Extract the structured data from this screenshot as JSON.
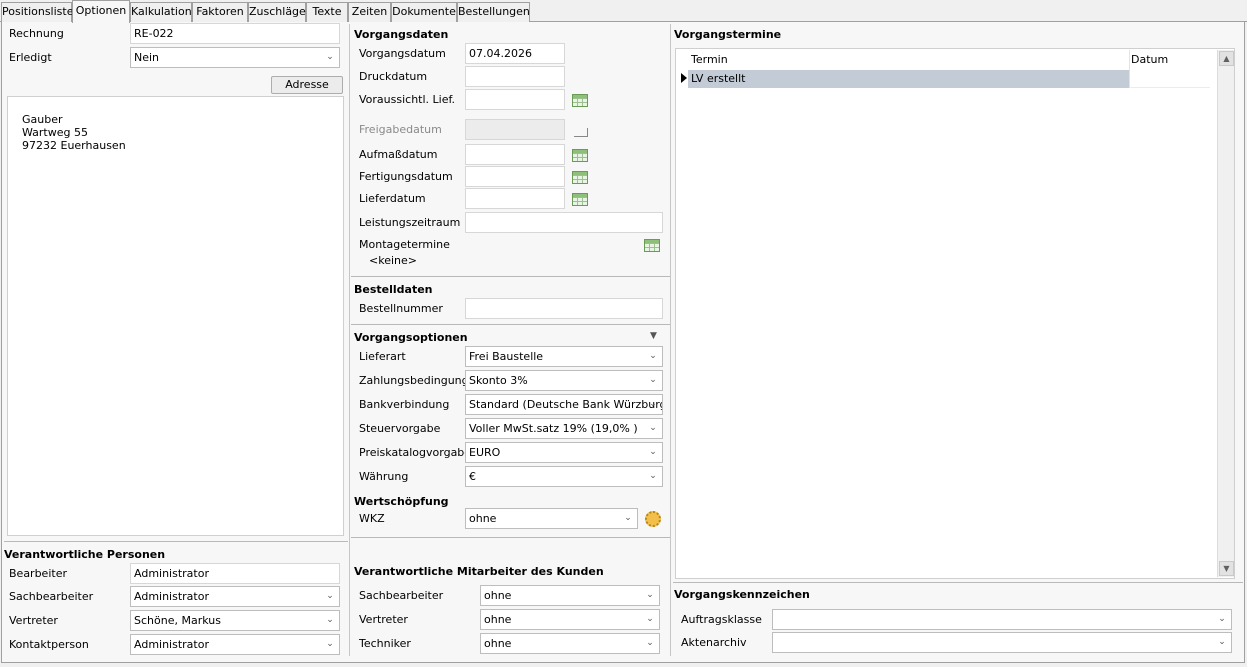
{
  "tabs": [
    "Positionsliste",
    "Optionen",
    "Kalkulation",
    "Faktoren",
    "Zuschläge",
    "Texte",
    "Zeiten",
    "Dokumente",
    "Bestellungen"
  ],
  "left": {
    "rechnung_label": "Rechnung",
    "rechnung_value": "RE-022",
    "erledigt_label": "Erledigt",
    "erledigt_value": "Nein",
    "adresse_button": "Adresse",
    "address_lines": [
      "Gauber",
      "Wartweg 55",
      "97232 Euerhausen"
    ],
    "personen_head": "Verantwortliche Personen",
    "bearbeiter_label": "Bearbeiter",
    "bearbeiter_value": "Administrator",
    "sachbearbeiter_label": "Sachbearbeiter",
    "sachbearbeiter_value": "Administrator",
    "vertreter_label": "Vertreter",
    "vertreter_value": "Schöne, Markus",
    "kontakt_label": "Kontaktperson",
    "kontakt_value": "Administrator"
  },
  "middle": {
    "vorgangsdaten_head": "Vorgangsdaten",
    "vorgangsdatum_label": "Vorgangsdatum",
    "vorgangsdatum_value": "07.04.2026",
    "druckdatum_label": "Druckdatum",
    "vorauss_label": "Voraussichtl. Lief.",
    "freigabe_label": "Freigabedatum",
    "aufmass_label": "Aufmaßdatum",
    "fertigung_label": "Fertigungsdatum",
    "liefer_label": "Lieferdatum",
    "leistung_label": "Leistungszeitraum",
    "montage_label": "Montagetermine",
    "montage_value": "<keine>",
    "bestelldaten_head": "Bestelldaten",
    "bestellnummer_label": "Bestellnummer",
    "optionen_head": "Vorgangsoptionen",
    "lieferart_label": "Lieferart",
    "lieferart_value": "Frei Baustelle",
    "zahlung_label": "Zahlungsbedingung",
    "zahlung_value": "Skonto 3%",
    "bank_label": "Bankverbindung",
    "bank_value": "Standard (Deutsche Bank Würzburg)",
    "steuer_label": "Steuervorgabe",
    "steuer_value": "Voller MwSt.satz 19% (19,0% )",
    "preis_label": "Preiskatalogvorgabe",
    "preis_value": "EURO",
    "waehrung_label": "Währung",
    "waehrung_value": "€",
    "wert_head": "Wertschöpfung",
    "wkz_label": "WKZ",
    "wkz_value": "ohne",
    "kunden_head": "Verantwortliche Mitarbeiter des Kunden",
    "k_sach_label": "Sachbearbeiter",
    "k_sach_value": "ohne",
    "k_vertreter_label": "Vertreter",
    "k_vertreter_value": "ohne",
    "k_techniker_label": "Techniker",
    "k_techniker_value": "ohne"
  },
  "right": {
    "termine_head": "Vorgangstermine",
    "col_termin": "Termin",
    "col_datum": "Datum",
    "rows": [
      {
        "termin": "LV erstellt",
        "datum": ""
      }
    ],
    "kennzeichen_head": "Vorgangskennzeichen",
    "auftragsklasse_label": "Auftragsklasse",
    "aktenarchiv_label": "Aktenarchiv"
  },
  "colors": {
    "selected_row": "#c3cbd7",
    "accent": "#0078d7"
  }
}
